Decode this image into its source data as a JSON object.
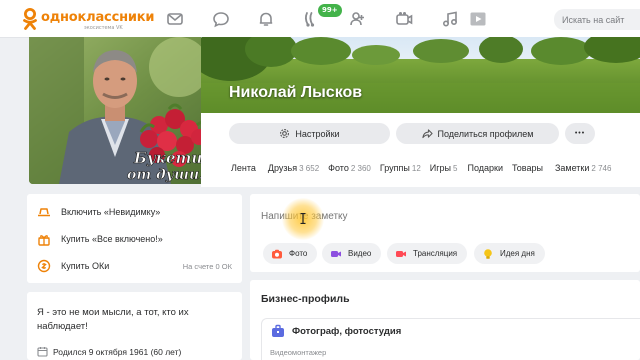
{
  "brand": {
    "name": "одноклассники",
    "sub": "экосистема VK",
    "color": "#ee8208"
  },
  "nav": {
    "icons": [
      "messages-icon",
      "discussions-icon",
      "notifications-icon",
      "guests-icon",
      "friends-requests-icon",
      "video-icon",
      "music-icon",
      "games-icon"
    ],
    "badge": "99+"
  },
  "search": {
    "placeholder": "Искать на сайт"
  },
  "profile": {
    "name": "Николай Лысков",
    "avatar_caption_line1": "Букетик",
    "avatar_caption_line2": "от души!",
    "settings_label": "Настройки",
    "share_label": "Поделиться профилем",
    "more_label": "•••"
  },
  "tabs": [
    {
      "label": "Лента",
      "count": ""
    },
    {
      "label": "Друзья",
      "count": "3 652"
    },
    {
      "label": "Фото",
      "count": "2 360"
    },
    {
      "label": "Группы",
      "count": "12"
    },
    {
      "label": "Игры",
      "count": "5"
    },
    {
      "label": "Подарки",
      "count": ""
    },
    {
      "label": "Товары",
      "count": ""
    },
    {
      "label": "Заметки",
      "count": "2 746"
    }
  ],
  "sidebar": {
    "invisible": "Включить «Невидимку»",
    "all_inclusive": "Купить «Все включено!»",
    "buy_ok": "Купить ОКи",
    "balance": "На счете 0 ОК"
  },
  "about": {
    "text": "Я - это не мои мысли, а тот, кто их наблюдает!",
    "born": "Родился 9 октября 1961 (60 лет)"
  },
  "composer": {
    "placeholder": "Напишите заметку",
    "chips": [
      "Фото",
      "Видео",
      "Трансляция",
      "Идея дня"
    ]
  },
  "business": {
    "title": "Бизнес-профиль",
    "name": "Фотограф, фотостудия",
    "sub": "Видеомонтажер"
  },
  "colors": {
    "accent": "#ee8208",
    "badge": "#43b34a",
    "photo_chip": "#ff5a3c",
    "video_chip": "#8d4fe0",
    "stream_chip": "#ff4a55",
    "idea_chip": "#f5c518",
    "biz_icon": "#5b6be0"
  }
}
